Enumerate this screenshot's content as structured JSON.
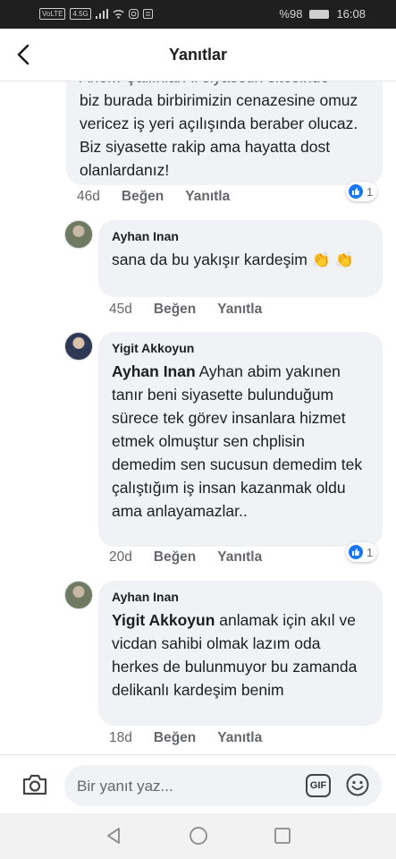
{
  "status_bar": {
    "left_icons": [
      "VoLTE",
      "4.5G",
      "signal",
      "wifi",
      "instagram",
      "notification"
    ],
    "battery_percent": "%98",
    "time": "16:08"
  },
  "header": {
    "title": "Yanıtlar"
  },
  "comments": [
    {
      "truncated_line": "Ahem Çallınları il siyasetin sitesinde",
      "text": "biz burada birbirimizin cenazesine omuz vericez iş yeri açılışında beraber olucaz. Biz siyasette rakip ama hayatta dost olanlardanız!",
      "time": "46d",
      "like_label": "Beğen",
      "reply_label": "Yanıtla",
      "reaction_count": "1"
    },
    {
      "author": "Ayhan Inan",
      "text": "sana da bu yakışır kardeşim",
      "emoji": "👏 👏",
      "time": "45d",
      "like_label": "Beğen",
      "reply_label": "Yanıtla"
    },
    {
      "author": "Yigit Akkoyun",
      "mention": "Ayhan Inan",
      "text": "Ayhan abim yakınen tanır beni siyasette bulunduğum sürece tek görev insanlara hizmet etmek olmuştur sen chplisin demedim sen sucusun demedim tek çalıştığım iş insan kazanmak oldu ama anlayamazlar..",
      "time": "20d",
      "like_label": "Beğen",
      "reply_label": "Yanıtla",
      "reaction_count": "1"
    },
    {
      "author": "Ayhan Inan",
      "mention": "Yigit Akkoyun",
      "text": "anlamak için akıl ve vicdan sahibi olmak lazım oda herkes de  bulunmuyor bu zamanda delikanlı kardeşim benim",
      "time": "18d",
      "like_label": "Beğen",
      "reply_label": "Yanıtla"
    }
  ],
  "composer": {
    "placeholder": "Bir yanıt yaz...",
    "gif_label": "GIF"
  },
  "icons": {
    "back": "back-arrow-icon",
    "camera": "camera-icon",
    "gif": "gif-icon",
    "emoji": "emoji-icon",
    "like": "like-icon",
    "nav_back": "nav-back-icon",
    "nav_home": "nav-home-icon",
    "nav_recent": "nav-recent-icon"
  },
  "colors": {
    "facebook_blue": "#1877f2",
    "bubble": "#f0f2f5",
    "meta_text": "#65676b"
  }
}
